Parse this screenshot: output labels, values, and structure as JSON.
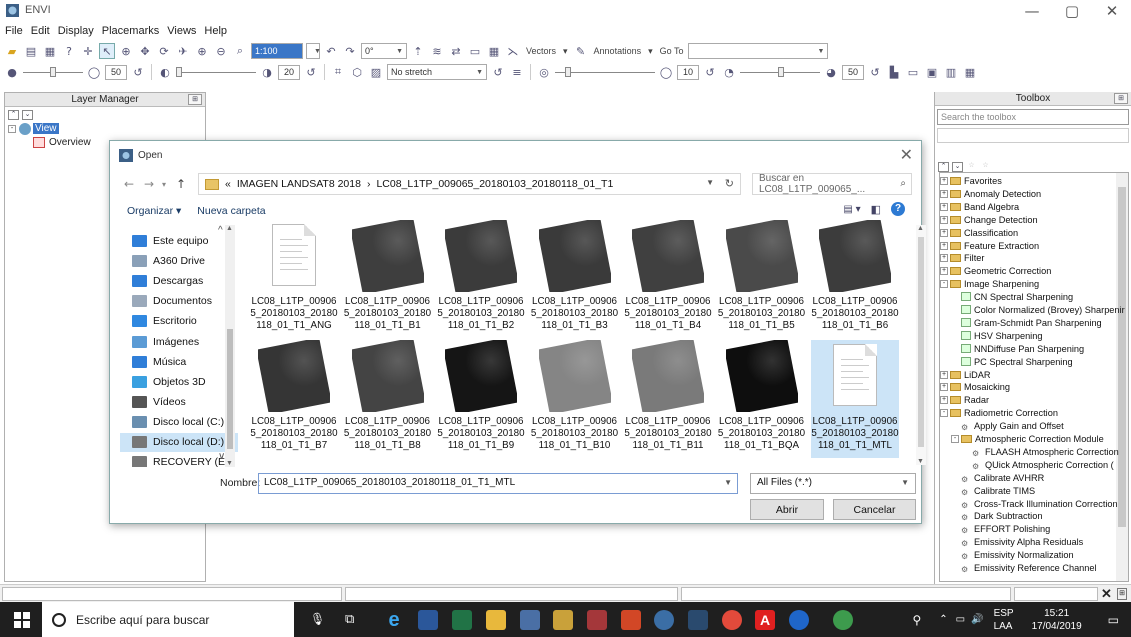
{
  "app": {
    "title": "ENVI"
  },
  "window_controls": {
    "minimize": "—",
    "maximize": "▢",
    "close": "✕"
  },
  "menu": [
    "File",
    "Edit",
    "Display",
    "Placemarks",
    "Views",
    "Help"
  ],
  "toolbar": {
    "scale_combo": "1:100",
    "rotation_combo": "0°",
    "vectors": "Vectors",
    "annotations": "Annotations",
    "goto_label": "Go To",
    "stretch_combo": "No stretch",
    "brightness": "50",
    "contrast": "20",
    "sharpen": "10",
    "transparency": "50"
  },
  "layer_manager": {
    "title": "Layer Manager",
    "view": "View",
    "overview": "Overview"
  },
  "toolbox": {
    "title": "Toolbox",
    "search_placeholder": "Search the toolbox",
    "items": [
      {
        "label": "Favorites",
        "level": 0,
        "kind": "folder",
        "exp": "+"
      },
      {
        "label": "Anomaly Detection",
        "level": 0,
        "kind": "folder",
        "exp": "+"
      },
      {
        "label": "Band Algebra",
        "level": 0,
        "kind": "folder",
        "exp": "+"
      },
      {
        "label": "Change Detection",
        "level": 0,
        "kind": "folder",
        "exp": "+"
      },
      {
        "label": "Classification",
        "level": 0,
        "kind": "folder",
        "exp": "+"
      },
      {
        "label": "Feature Extraction",
        "level": 0,
        "kind": "folder",
        "exp": "+"
      },
      {
        "label": "Filter",
        "level": 0,
        "kind": "folder",
        "exp": "+"
      },
      {
        "label": "Geometric Correction",
        "level": 0,
        "kind": "folder",
        "exp": "+"
      },
      {
        "label": "Image Sharpening",
        "level": 0,
        "kind": "folder",
        "exp": "-"
      },
      {
        "label": "CN Spectral Sharpening",
        "level": 1,
        "kind": "tool"
      },
      {
        "label": "Color Normalized (Brovey) Sharpenir",
        "level": 1,
        "kind": "tool"
      },
      {
        "label": "Gram-Schmidt Pan Sharpening",
        "level": 1,
        "kind": "tool"
      },
      {
        "label": "HSV Sharpening",
        "level": 1,
        "kind": "tool"
      },
      {
        "label": "NNDiffuse Pan Sharpening",
        "level": 1,
        "kind": "tool"
      },
      {
        "label": "PC Spectral Sharpening",
        "level": 1,
        "kind": "tool"
      },
      {
        "label": "LiDAR",
        "level": 0,
        "kind": "folder",
        "exp": "+"
      },
      {
        "label": "Mosaicking",
        "level": 0,
        "kind": "folder",
        "exp": "+"
      },
      {
        "label": "Radar",
        "level": 0,
        "kind": "folder",
        "exp": "+"
      },
      {
        "label": "Radiometric Correction",
        "level": 0,
        "kind": "folder",
        "exp": "-"
      },
      {
        "label": "Apply Gain and Offset",
        "level": 1,
        "kind": "gear"
      },
      {
        "label": "Atmospheric Correction Module",
        "level": 1,
        "kind": "folder",
        "exp": "-"
      },
      {
        "label": "FLAASH Atmospheric Correction",
        "level": 2,
        "kind": "gear"
      },
      {
        "label": "QUick Atmospheric Correction (",
        "level": 2,
        "kind": "gear"
      },
      {
        "label": "Calibrate AVHRR",
        "level": 1,
        "kind": "gear"
      },
      {
        "label": "Calibrate TIMS",
        "level": 1,
        "kind": "gear"
      },
      {
        "label": "Cross-Track Illumination Correction",
        "level": 1,
        "kind": "gear"
      },
      {
        "label": "Dark Subtraction",
        "level": 1,
        "kind": "gear"
      },
      {
        "label": "EFFORT Polishing",
        "level": 1,
        "kind": "gear"
      },
      {
        "label": "Emissivity Alpha Residuals",
        "level": 1,
        "kind": "gear"
      },
      {
        "label": "Emissivity Normalization",
        "level": 1,
        "kind": "gear"
      },
      {
        "label": "Emissivity Reference Channel",
        "level": 1,
        "kind": "gear"
      }
    ]
  },
  "dialog": {
    "title": "Open",
    "path": [
      "«",
      "IMAGEN LANDSAT8 2018",
      "›",
      "LC08_L1TP_009065_20180103_20180118_01_T1"
    ],
    "search_placeholder": "Buscar en LC08_L1TP_009065_...",
    "organize": "Organizar ▾",
    "new_folder": "Nueva carpeta",
    "nav_items": [
      {
        "label": "Este equipo",
        "color": "#2f7ed8"
      },
      {
        "label": "A360 Drive",
        "color": "#8aa0b8"
      },
      {
        "label": "Descargas",
        "color": "#2f7ed8"
      },
      {
        "label": "Documentos",
        "color": "#9aa9bb"
      },
      {
        "label": "Escritorio",
        "color": "#2f88e0"
      },
      {
        "label": "Imágenes",
        "color": "#5b9bd5"
      },
      {
        "label": "Música",
        "color": "#2f7ed8"
      },
      {
        "label": "Objetos 3D",
        "color": "#3aa0e0"
      },
      {
        "label": "Vídeos",
        "color": "#555555"
      },
      {
        "label": "Disco local (C:)",
        "color": "#6a8fb0"
      },
      {
        "label": "Disco local (D:)",
        "color": "#777777"
      },
      {
        "label": "RECOVERY (E:)",
        "color": "#777777"
      }
    ],
    "files": [
      {
        "name": "LC08_L1TP_009065_20180103_20180118_01_T1_ANG",
        "kind": "doc"
      },
      {
        "name": "LC08_L1TP_009065_20180103_20180118_01_T1_B1",
        "kind": "img",
        "tone": "#3e3e3e"
      },
      {
        "name": "LC08_L1TP_009065_20180103_20180118_01_T1_B2",
        "kind": "img",
        "tone": "#3b3b3b"
      },
      {
        "name": "LC08_L1TP_009065_20180103_20180118_01_T1_B3",
        "kind": "img",
        "tone": "#3a3a3a"
      },
      {
        "name": "LC08_L1TP_009065_20180103_20180118_01_T1_B4",
        "kind": "img",
        "tone": "#404040"
      },
      {
        "name": "LC08_L1TP_009065_20180103_20180118_01_T1_B5",
        "kind": "img",
        "tone": "#4a4a4a"
      },
      {
        "name": "LC08_L1TP_009065_20180103_20180118_01_T1_B6",
        "kind": "img",
        "tone": "#3c3c3c"
      },
      {
        "name": "LC08_L1TP_009065_20180103_20180118_01_T1_B7",
        "kind": "img",
        "tone": "#353535"
      },
      {
        "name": "LC08_L1TP_009065_20180103_20180118_01_T1_B8",
        "kind": "img",
        "tone": "#444444"
      },
      {
        "name": "LC08_L1TP_009065_20180103_20180118_01_T1_B9",
        "kind": "img",
        "tone": "#151515"
      },
      {
        "name": "LC08_L1TP_009065_20180103_20180118_01_T1_B10",
        "kind": "img",
        "tone": "#858585"
      },
      {
        "name": "LC08_L1TP_009065_20180103_20180118_01_T1_B11",
        "kind": "img",
        "tone": "#7a7a7a"
      },
      {
        "name": "LC08_L1TP_009065_20180103_20180118_01_T1_BQA",
        "kind": "img",
        "tone": "#0e0e0e"
      },
      {
        "name": "LC08_L1TP_009065_20180103_20180118_01_T1_MTL",
        "kind": "doc",
        "selected": true
      }
    ],
    "name_label": "Nombre:",
    "name_value": "LC08_L1TP_009065_20180103_20180118_01_T1_MTL",
    "type_value": "All Files (*.*)",
    "open_button": "Abrir",
    "cancel_button": "Cancelar"
  },
  "taskbar": {
    "search_placeholder": "Escribe aquí para buscar",
    "lang_top": "ESP",
    "lang_bottom": "LAA",
    "time": "15:21",
    "date": "17/04/2019"
  }
}
